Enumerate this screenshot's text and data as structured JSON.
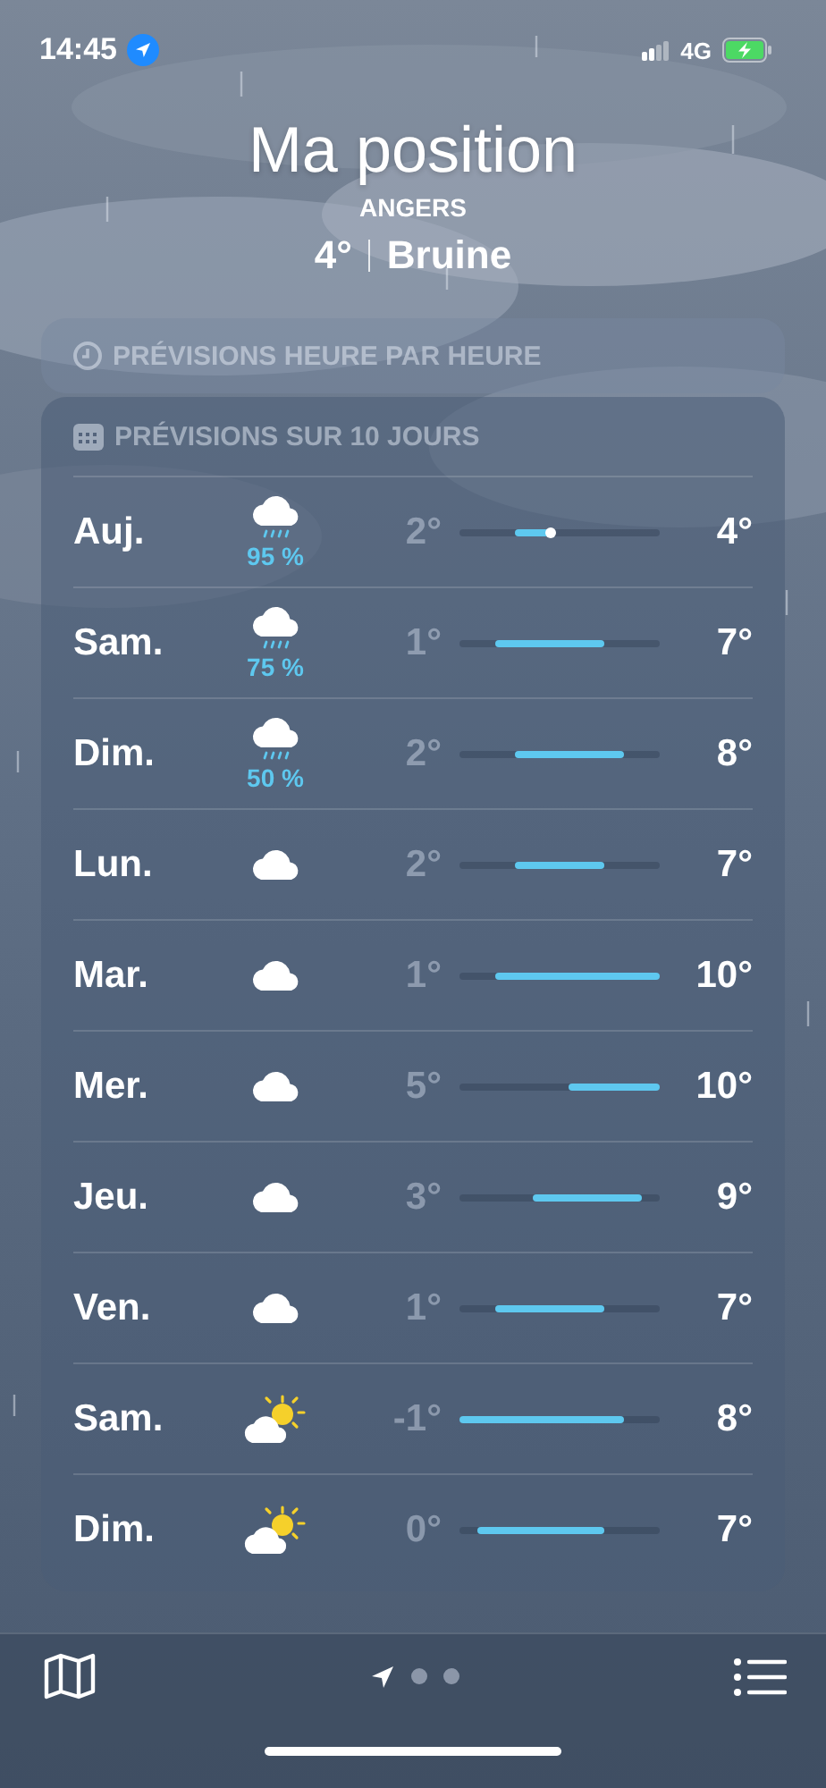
{
  "status_bar": {
    "time": "14:45",
    "network": "4G"
  },
  "header": {
    "title": "Ma position",
    "city": "ANGERS",
    "temperature": "4°",
    "condition": "Bruine"
  },
  "hourly": {
    "title": "PRÉVISIONS HEURE PAR HEURE"
  },
  "daily": {
    "title": "PRÉVISIONS SUR 10 JOURS",
    "rows": [
      {
        "day": "Auj.",
        "kind": "rain",
        "precip": "95 %",
        "low": "2°",
        "high": "4°",
        "current": true
      },
      {
        "day": "Sam.",
        "kind": "rain",
        "precip": "75 %",
        "low": "1°",
        "high": "7°",
        "current": false
      },
      {
        "day": "Dim.",
        "kind": "rain",
        "precip": "50 %",
        "low": "2°",
        "high": "8°",
        "current": false
      },
      {
        "day": "Lun.",
        "kind": "cloud",
        "low": "2°",
        "high": "7°",
        "current": false
      },
      {
        "day": "Mar.",
        "kind": "cloud",
        "low": "1°",
        "high": "10°",
        "current": false
      },
      {
        "day": "Mer.",
        "kind": "cloud",
        "low": "5°",
        "high": "10°",
        "current": false
      },
      {
        "day": "Jeu.",
        "kind": "cloud",
        "low": "3°",
        "high": "9°",
        "current": false
      },
      {
        "day": "Ven.",
        "kind": "cloud",
        "low": "1°",
        "high": "7°",
        "current": false
      },
      {
        "day": "Sam.",
        "kind": "sun_cloud",
        "low": "-1°",
        "high": "8°",
        "current": false
      },
      {
        "day": "Dim.",
        "kind": "sun_cloud",
        "low": "0°",
        "high": "7°",
        "current": false
      }
    ]
  },
  "pager": [
    {
      "kind": "location",
      "selected": true
    },
    {
      "kind": "dot",
      "selected": false
    },
    {
      "kind": "dot",
      "selected": false
    }
  ]
}
